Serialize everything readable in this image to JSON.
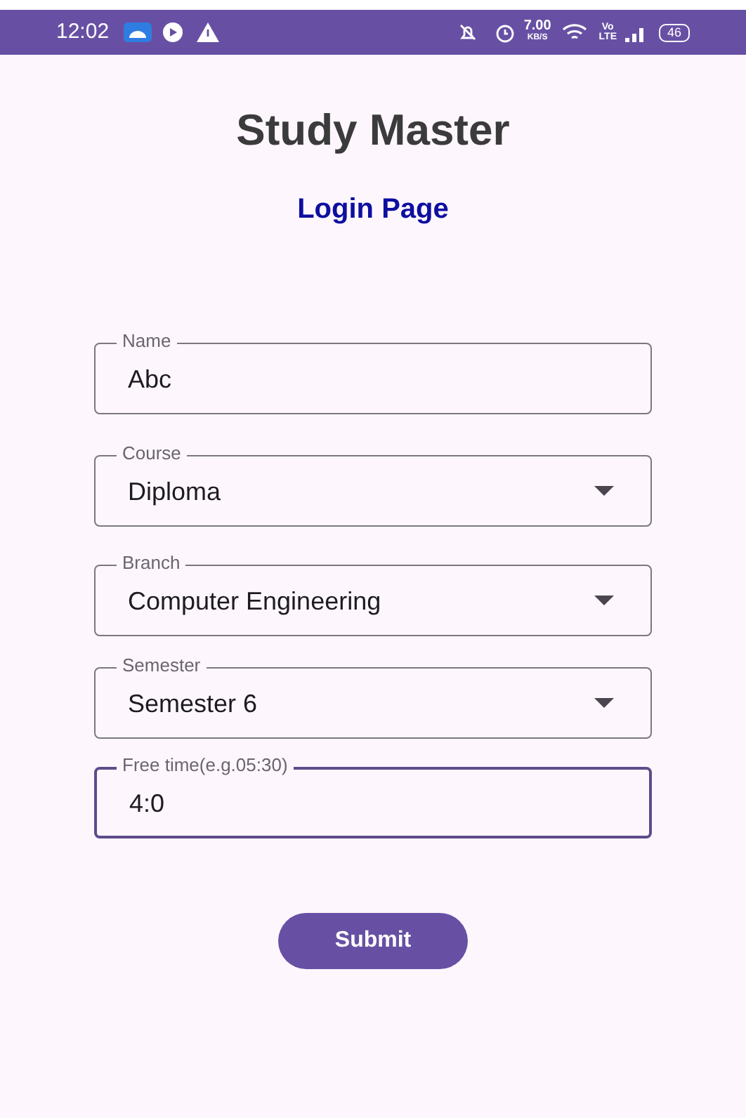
{
  "status_bar": {
    "time": "12:02",
    "speed_value": "7.00",
    "speed_unit": "KB/S",
    "volte_top": "Vo",
    "volte_bottom": "LTE",
    "battery": "46"
  },
  "title": "Study Master",
  "subtitle": "Login Page",
  "fields": [
    {
      "kind": "text",
      "label": "Name",
      "value": "Abc",
      "focused": false
    },
    {
      "kind": "dropdown",
      "label": "Course",
      "value": "Diploma",
      "focused": false
    },
    {
      "kind": "dropdown",
      "label": "Branch",
      "value": "Computer Engineering",
      "focused": false
    },
    {
      "kind": "dropdown",
      "label": "Semester",
      "value": "Semester 6",
      "focused": false
    },
    {
      "kind": "text",
      "label": "Free time(e.g.05:30)",
      "value": "4:0",
      "focused": true
    }
  ],
  "submit": "Submit"
}
